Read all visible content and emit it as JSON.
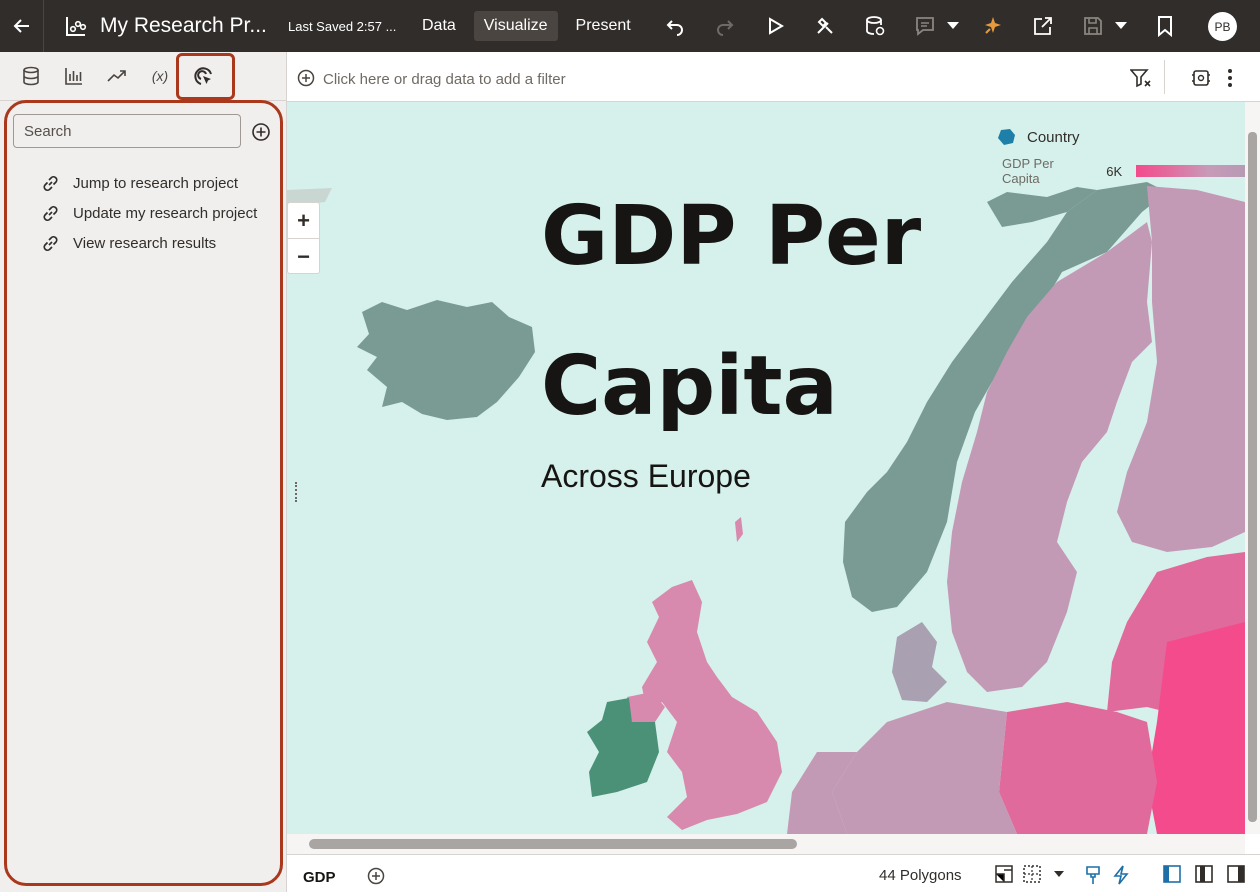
{
  "topbar": {
    "title": "My Research Pr...",
    "last_saved": "Last Saved 2:57 ...",
    "tabs": [
      "Data",
      "Visualize",
      "Present"
    ],
    "active_tab": "Visualize",
    "avatar_initials": "PB"
  },
  "left_panel": {
    "tabs": [
      "data-icon",
      "visualizations-icon",
      "analytics-icon",
      "calculations-icon",
      "actions-icon"
    ],
    "calculation_tab_label": "(x)",
    "search_placeholder": "Search",
    "actions": [
      {
        "label": "Jump to research project",
        "icon": "link-icon"
      },
      {
        "label": "Update my research project",
        "icon": "link-icon"
      },
      {
        "label": "View research results",
        "icon": "link-icon"
      }
    ]
  },
  "filter_bar": {
    "placeholder": "Click here or drag data to add a filter"
  },
  "canvas": {
    "title_line1": "GDP Per",
    "title_line2": "Capita",
    "subtitle": "Across Europe",
    "legend": {
      "title": "Country",
      "measure": "GDP Per Capita",
      "min_label": "6K"
    },
    "colors": {
      "sea": "#d6f1eb",
      "nordic": "#7a9b94",
      "sweden_finland": "#c39ab6",
      "uk": "#d88aae",
      "ireland": "#4a9178",
      "baltics": "#e06a9c",
      "east": "#f34b8c",
      "denmark": "#a9a0b2"
    }
  },
  "bottom_bar": {
    "canvas_tab": "GDP",
    "polygon_count": "44 Polygons"
  },
  "annotations": {
    "highlight_color": "#a9381c"
  }
}
